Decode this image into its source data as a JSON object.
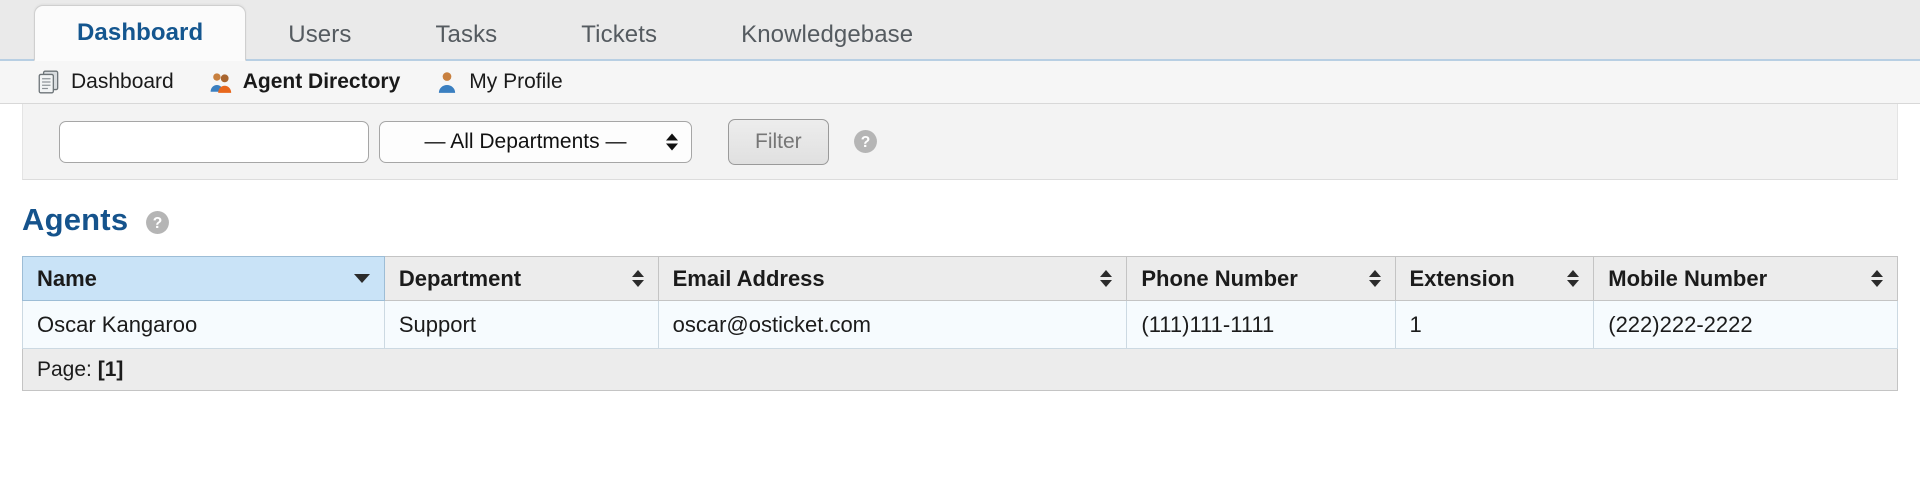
{
  "tabs": [
    {
      "label": "Dashboard",
      "active": true
    },
    {
      "label": "Users",
      "active": false
    },
    {
      "label": "Tasks",
      "active": false
    },
    {
      "label": "Tickets",
      "active": false
    },
    {
      "label": "Knowledgebase",
      "active": false
    }
  ],
  "subnav": [
    {
      "label": "Dashboard",
      "icon": "pages-icon",
      "active": false
    },
    {
      "label": "Agent Directory",
      "icon": "two-people-icon",
      "active": true
    },
    {
      "label": "My Profile",
      "icon": "person-icon",
      "active": false
    }
  ],
  "filterbar": {
    "search_value": "",
    "search_placeholder": "",
    "department_selected": "— All Departments —",
    "filter_label": "Filter",
    "help_icon": "help-circle-icon"
  },
  "page": {
    "title": "Agents",
    "help_icon": "help-circle-icon"
  },
  "table": {
    "columns": [
      {
        "label": "Name",
        "sort": "desc"
      },
      {
        "label": "Department",
        "sort": "both"
      },
      {
        "label": "Email Address",
        "sort": "both"
      },
      {
        "label": "Phone Number",
        "sort": "both"
      },
      {
        "label": "Extension",
        "sort": "both"
      },
      {
        "label": "Mobile Number",
        "sort": "both"
      }
    ],
    "rows": [
      {
        "name": "Oscar Kangaroo",
        "department": "Support",
        "email": "oscar@osticket.com",
        "phone": "(111)111-1111",
        "extension": "1",
        "mobile": "(222)222-2222"
      }
    ],
    "pager_prefix": "Page:",
    "pager_current": "[1]"
  },
  "colors": {
    "accent_blue": "#15538c",
    "sorted_header": "#c9e3f7",
    "row_bg": "#f6fbfe"
  }
}
